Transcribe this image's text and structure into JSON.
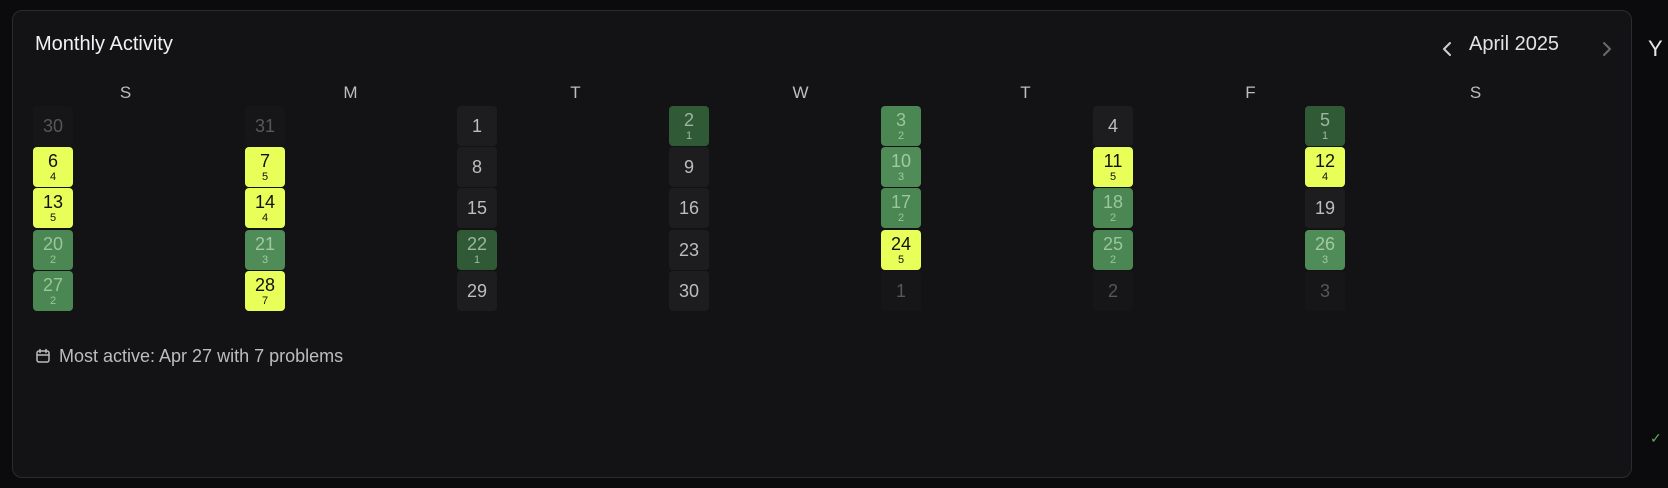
{
  "header": {
    "title": "Monthly Activity",
    "month_label": "April 2025",
    "prev_icon": "chevron-left-icon",
    "next_icon": "chevron-right-icon"
  },
  "side_panel": {
    "partial_text": "Y"
  },
  "weekdays": [
    "S",
    "M",
    "T",
    "W",
    "T",
    "F",
    "S"
  ],
  "calendar": {
    "rows": [
      [
        {
          "day": "30",
          "count": "",
          "level": "out"
        },
        {
          "day": "31",
          "count": "",
          "level": "out"
        },
        {
          "day": "1",
          "count": "",
          "level": "0"
        },
        {
          "day": "2",
          "count": "1",
          "level": "1"
        },
        {
          "day": "3",
          "count": "2",
          "level": "2"
        },
        {
          "day": "4",
          "count": "",
          "level": "0"
        },
        {
          "day": "5",
          "count": "1",
          "level": "1"
        }
      ],
      [
        {
          "day": "6",
          "count": "4",
          "level": "hot"
        },
        {
          "day": "7",
          "count": "5",
          "level": "hot"
        },
        {
          "day": "8",
          "count": "",
          "level": "0"
        },
        {
          "day": "9",
          "count": "",
          "level": "0"
        },
        {
          "day": "10",
          "count": "3",
          "level": "3"
        },
        {
          "day": "11",
          "count": "5",
          "level": "hot"
        },
        {
          "day": "12",
          "count": "4",
          "level": "hot"
        }
      ],
      [
        {
          "day": "13",
          "count": "5",
          "level": "hot"
        },
        {
          "day": "14",
          "count": "4",
          "level": "hot"
        },
        {
          "day": "15",
          "count": "",
          "level": "0"
        },
        {
          "day": "16",
          "count": "",
          "level": "0"
        },
        {
          "day": "17",
          "count": "2",
          "level": "2"
        },
        {
          "day": "18",
          "count": "2",
          "level": "2"
        },
        {
          "day": "19",
          "count": "",
          "level": "0"
        }
      ],
      [
        {
          "day": "20",
          "count": "2",
          "level": "2"
        },
        {
          "day": "21",
          "count": "3",
          "level": "3"
        },
        {
          "day": "22",
          "count": "1",
          "level": "1"
        },
        {
          "day": "23",
          "count": "",
          "level": "0"
        },
        {
          "day": "24",
          "count": "5",
          "level": "hot"
        },
        {
          "day": "25",
          "count": "2",
          "level": "2"
        },
        {
          "day": "26",
          "count": "3",
          "level": "3"
        }
      ],
      [
        {
          "day": "27",
          "count": "2",
          "level": "2"
        },
        {
          "day": "28",
          "count": "7",
          "level": "hot"
        },
        {
          "day": "29",
          "count": "",
          "level": "0"
        },
        {
          "day": "30",
          "count": "",
          "level": "0"
        },
        {
          "day": "1",
          "count": "",
          "level": "out"
        },
        {
          "day": "2",
          "count": "",
          "level": "out"
        },
        {
          "day": "3",
          "count": "",
          "level": "out"
        }
      ]
    ]
  },
  "footer": {
    "icon": "calendar-icon",
    "text": "Most active: Apr 27 with 7 problems"
  },
  "colors": {
    "hot": "#e8ff5a",
    "level_1": "#2f5a35",
    "level_2": "#4a8752",
    "level_3": "#4f8c57",
    "empty": "#1d1d20"
  }
}
